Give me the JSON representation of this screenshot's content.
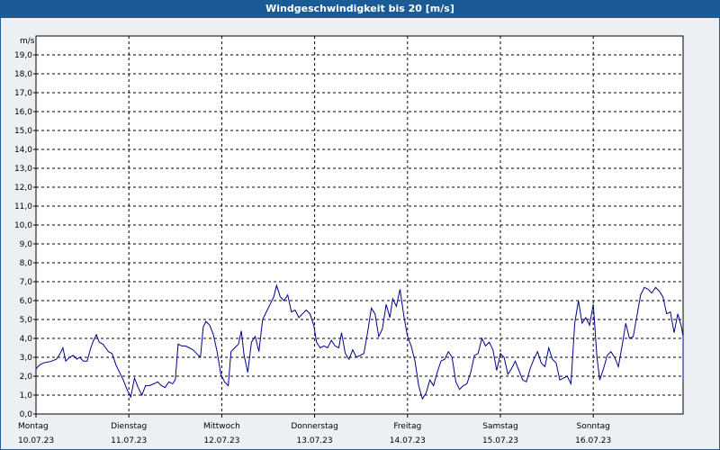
{
  "window": {
    "title": "Windgeschwindigkeit bis 20 [m/s]"
  },
  "chart_data": {
    "type": "line",
    "title": "Windgeschwindigkeit bis 20 [m/s]",
    "ylabel": "m/s",
    "xlabel": "",
    "ylim": [
      0,
      20
    ],
    "yticks": [
      "0,0",
      "1,0",
      "2,0",
      "3,0",
      "4,0",
      "5,0",
      "6,0",
      "7,0",
      "8,0",
      "9,0",
      "10,0",
      "11,0",
      "12,0",
      "13,0",
      "14,0",
      "15,0",
      "16,0",
      "17,0",
      "18,0",
      "19,0"
    ],
    "grid": true,
    "x_day_labels": [
      {
        "day": "Montag",
        "date": "10.07.23"
      },
      {
        "day": "Dienstag",
        "date": "11.07.23"
      },
      {
        "day": "Mittwoch",
        "date": "12.07.23"
      },
      {
        "day": "Donnerstag",
        "date": "13.07.23"
      },
      {
        "day": "Freitag",
        "date": "14.07.23"
      },
      {
        "day": "Samstag",
        "date": "15.07.23"
      },
      {
        "day": "Sonntag",
        "date": "16.07.23"
      }
    ],
    "series": [
      {
        "color": "#00008b",
        "x_unit": "days since 10.07.23 00:00",
        "values": [
          [
            0.0,
            2.4
          ],
          [
            0.04,
            2.6
          ],
          [
            0.08,
            2.7
          ],
          [
            0.13,
            2.75
          ],
          [
            0.17,
            2.8
          ],
          [
            0.22,
            2.9
          ],
          [
            0.26,
            3.2
          ],
          [
            0.29,
            3.5
          ],
          [
            0.32,
            2.8
          ],
          [
            0.36,
            3.0
          ],
          [
            0.4,
            3.1
          ],
          [
            0.44,
            2.9
          ],
          [
            0.47,
            3.0
          ],
          [
            0.51,
            2.8
          ],
          [
            0.55,
            2.8
          ],
          [
            0.59,
            3.5
          ],
          [
            0.62,
            3.9
          ],
          [
            0.65,
            4.2
          ],
          [
            0.68,
            3.8
          ],
          [
            0.72,
            3.7
          ],
          [
            0.75,
            3.5
          ],
          [
            0.78,
            3.3
          ],
          [
            0.82,
            3.2
          ],
          [
            0.86,
            2.6
          ],
          [
            0.9,
            2.2
          ],
          [
            0.94,
            1.8
          ],
          [
            0.98,
            1.3
          ],
          [
            1.02,
            0.9
          ],
          [
            1.06,
            1.9
          ],
          [
            1.1,
            1.4
          ],
          [
            1.14,
            1.0
          ],
          [
            1.18,
            1.5
          ],
          [
            1.22,
            1.5
          ],
          [
            1.27,
            1.6
          ],
          [
            1.31,
            1.7
          ],
          [
            1.35,
            1.5
          ],
          [
            1.39,
            1.4
          ],
          [
            1.43,
            1.7
          ],
          [
            1.47,
            1.6
          ],
          [
            1.5,
            1.8
          ],
          [
            1.53,
            3.7
          ],
          [
            1.57,
            3.6
          ],
          [
            1.61,
            3.6
          ],
          [
            1.65,
            3.5
          ],
          [
            1.69,
            3.4
          ],
          [
            1.73,
            3.2
          ],
          [
            1.77,
            3.0
          ],
          [
            1.8,
            4.6
          ],
          [
            1.83,
            4.9
          ],
          [
            1.87,
            4.7
          ],
          [
            1.91,
            4.2
          ],
          [
            1.95,
            3.3
          ],
          [
            1.99,
            2.1
          ],
          [
            2.03,
            1.7
          ],
          [
            2.07,
            1.5
          ],
          [
            2.1,
            3.3
          ],
          [
            2.14,
            3.5
          ],
          [
            2.18,
            3.7
          ],
          [
            2.21,
            4.4
          ],
          [
            2.24,
            3.1
          ],
          [
            2.28,
            2.2
          ],
          [
            2.32,
            3.8
          ],
          [
            2.36,
            4.1
          ],
          [
            2.4,
            3.3
          ],
          [
            2.44,
            5.0
          ],
          [
            2.48,
            5.4
          ],
          [
            2.52,
            5.8
          ],
          [
            2.56,
            6.2
          ],
          [
            2.59,
            6.8
          ],
          [
            2.63,
            6.2
          ],
          [
            2.67,
            6.0
          ],
          [
            2.71,
            6.3
          ],
          [
            2.75,
            5.4
          ],
          [
            2.79,
            5.5
          ],
          [
            2.83,
            5.1
          ],
          [
            2.87,
            5.3
          ],
          [
            2.91,
            5.5
          ],
          [
            2.95,
            5.3
          ],
          [
            2.99,
            4.7
          ],
          [
            3.02,
            3.8
          ],
          [
            3.06,
            3.5
          ],
          [
            3.1,
            3.6
          ],
          [
            3.14,
            3.5
          ],
          [
            3.18,
            3.9
          ],
          [
            3.22,
            3.6
          ],
          [
            3.26,
            3.5
          ],
          [
            3.29,
            4.3
          ],
          [
            3.33,
            3.2
          ],
          [
            3.37,
            2.9
          ],
          [
            3.41,
            3.4
          ],
          [
            3.45,
            3.0
          ],
          [
            3.49,
            3.1
          ],
          [
            3.53,
            3.2
          ],
          [
            3.57,
            4.3
          ],
          [
            3.61,
            5.6
          ],
          [
            3.65,
            5.3
          ],
          [
            3.69,
            4.1
          ],
          [
            3.73,
            4.5
          ],
          [
            3.77,
            5.8
          ],
          [
            3.81,
            5.1
          ],
          [
            3.84,
            6.1
          ],
          [
            3.88,
            5.7
          ],
          [
            3.92,
            6.6
          ],
          [
            3.96,
            5.2
          ],
          [
            4.0,
            4.1
          ],
          [
            4.04,
            3.6
          ],
          [
            4.08,
            2.8
          ],
          [
            4.12,
            1.5
          ],
          [
            4.16,
            0.8
          ],
          [
            4.2,
            1.1
          ],
          [
            4.24,
            1.8
          ],
          [
            4.28,
            1.5
          ],
          [
            4.32,
            2.2
          ],
          [
            4.36,
            2.8
          ],
          [
            4.4,
            2.9
          ],
          [
            4.44,
            3.3
          ],
          [
            4.48,
            3.0
          ],
          [
            4.52,
            1.7
          ],
          [
            4.56,
            1.3
          ],
          [
            4.6,
            1.5
          ],
          [
            4.64,
            1.6
          ],
          [
            4.68,
            2.2
          ],
          [
            4.72,
            3.1
          ],
          [
            4.76,
            3.2
          ],
          [
            4.8,
            4.0
          ],
          [
            4.84,
            3.6
          ],
          [
            4.88,
            3.8
          ],
          [
            4.92,
            3.4
          ],
          [
            4.96,
            2.3
          ],
          [
            5.0,
            3.2
          ],
          [
            5.04,
            3.0
          ],
          [
            5.08,
            2.1
          ],
          [
            5.12,
            2.4
          ],
          [
            5.16,
            2.8
          ],
          [
            5.2,
            2.3
          ],
          [
            5.24,
            1.8
          ],
          [
            5.28,
            1.7
          ],
          [
            5.32,
            2.4
          ],
          [
            5.36,
            2.9
          ],
          [
            5.4,
            3.3
          ],
          [
            5.44,
            2.7
          ],
          [
            5.48,
            2.5
          ],
          [
            5.52,
            3.5
          ],
          [
            5.56,
            2.9
          ],
          [
            5.6,
            2.7
          ],
          [
            5.64,
            1.8
          ],
          [
            5.68,
            1.9
          ],
          [
            5.72,
            2.0
          ],
          [
            5.76,
            1.6
          ],
          [
            5.8,
            4.8
          ],
          [
            5.84,
            6.0
          ],
          [
            5.88,
            4.8
          ],
          [
            5.92,
            5.1
          ],
          [
            5.96,
            4.7
          ],
          [
            6.0,
            5.8
          ],
          [
            6.04,
            3.0
          ],
          [
            6.07,
            1.8
          ],
          [
            6.11,
            2.4
          ],
          [
            6.15,
            3.1
          ],
          [
            6.19,
            3.3
          ],
          [
            6.23,
            3.0
          ],
          [
            6.27,
            2.5
          ],
          [
            6.31,
            3.6
          ],
          [
            6.35,
            4.8
          ],
          [
            6.39,
            4.0
          ],
          [
            6.43,
            4.1
          ],
          [
            6.47,
            5.2
          ],
          [
            6.51,
            6.3
          ],
          [
            6.55,
            6.7
          ],
          [
            6.59,
            6.6
          ],
          [
            6.63,
            6.4
          ],
          [
            6.67,
            6.7
          ],
          [
            6.71,
            6.5
          ],
          [
            6.75,
            6.2
          ],
          [
            6.79,
            5.3
          ],
          [
            6.83,
            5.4
          ],
          [
            6.87,
            4.3
          ],
          [
            6.91,
            5.3
          ],
          [
            6.95,
            4.6
          ],
          [
            6.99,
            4.1
          ],
          [
            7.03,
            2.6
          ],
          [
            7.07,
            2.7
          ],
          [
            7.11,
            1.8
          ]
        ]
      }
    ]
  }
}
